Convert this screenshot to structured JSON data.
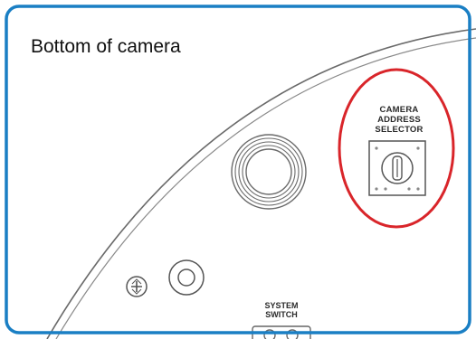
{
  "title": "Bottom of camera",
  "camera_address_selector": {
    "lines": [
      "CAMERA",
      "ADDRESS",
      "SELECTOR"
    ]
  },
  "system_switch": {
    "lines": [
      "SYSTEM",
      "SWITCH"
    ]
  },
  "colors": {
    "frame_border": "#1a7fc4",
    "highlight_ellipse": "#d9252a",
    "line_art": "#555555",
    "background": "#ffffff"
  }
}
